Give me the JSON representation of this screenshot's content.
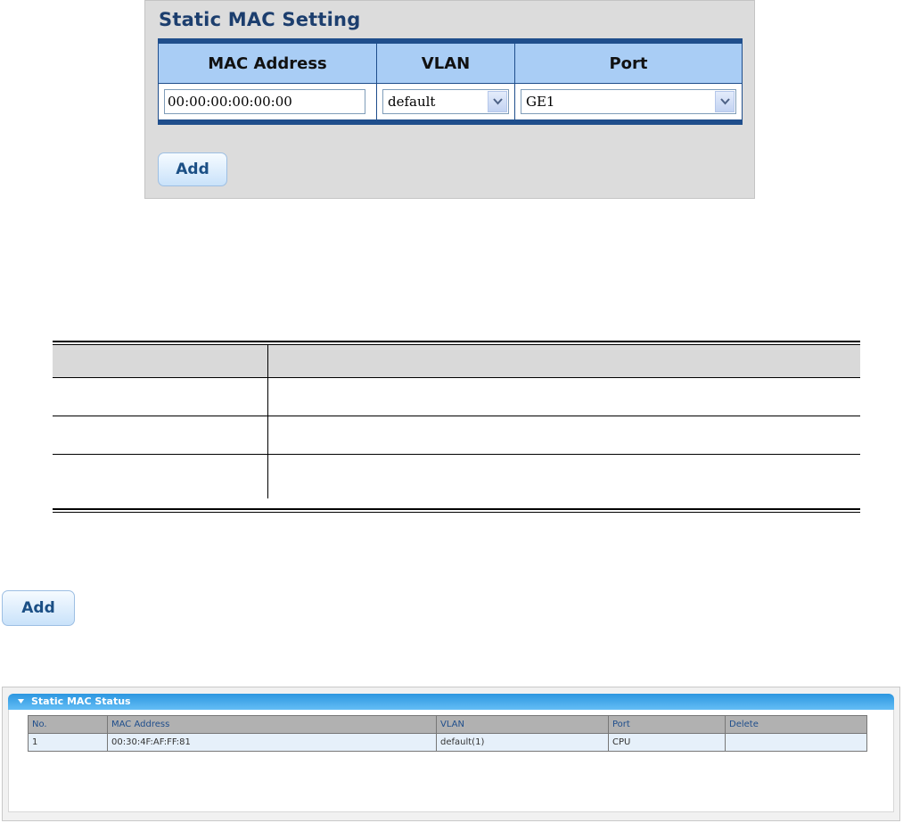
{
  "setting_panel": {
    "title": "Static MAC Setting",
    "columns": [
      "MAC Address",
      "VLAN",
      "Port"
    ],
    "mac_value": "00:00:00:00:00:00",
    "vlan_selected": "default",
    "port_selected": "GE1",
    "add_label": "Add"
  },
  "standalone_button": {
    "label": "Add"
  },
  "status_panel": {
    "title": "Static MAC Status",
    "headers": [
      "No.",
      "MAC Address",
      "VLAN",
      "Port",
      "Delete"
    ],
    "rows": [
      {
        "no": "1",
        "mac": "00:30:4F:AF:FF:81",
        "vlan": "default(1)",
        "port": "CPU",
        "delete": ""
      }
    ]
  }
}
